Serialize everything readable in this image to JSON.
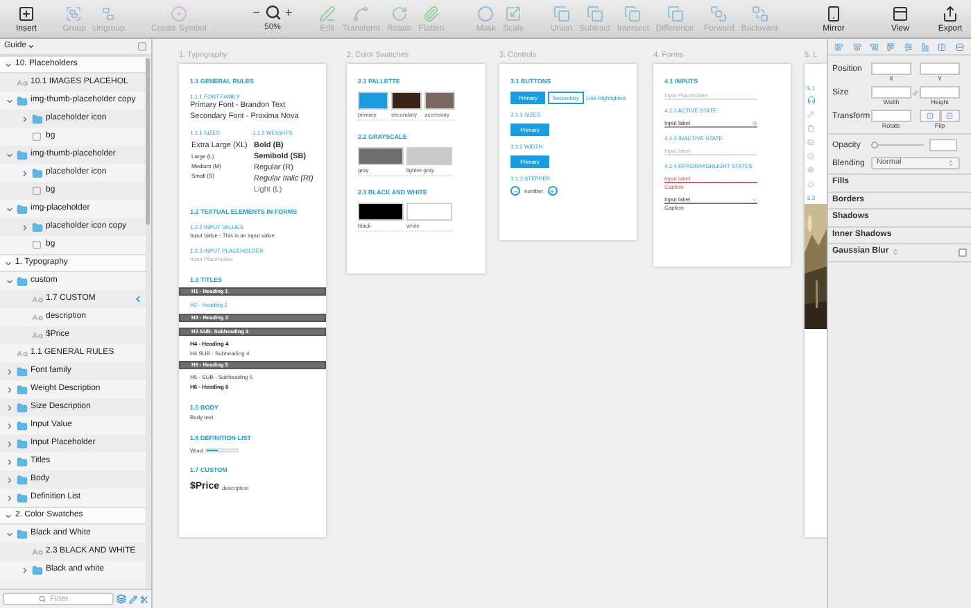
{
  "toolbar": {
    "groups": [
      [
        {
          "kind": "tool",
          "label": "Insert",
          "disabled": false
        }
      ],
      [
        {
          "kind": "tool",
          "label": "Group",
          "disabled": true
        },
        {
          "kind": "tool",
          "label": "Ungroup",
          "disabled": true
        }
      ],
      [
        {
          "kind": "tool",
          "label": "Create Symbol",
          "disabled": true
        }
      ],
      [
        {
          "kind": "zoom",
          "minus": "−",
          "plus": "+",
          "value": "50%"
        }
      ],
      [
        {
          "kind": "tool",
          "label": "Edit",
          "disabled": true
        },
        {
          "kind": "tool",
          "label": "Transform",
          "disabled": true
        },
        {
          "kind": "tool",
          "label": "Rotate",
          "disabled": true
        },
        {
          "kind": "tool",
          "label": "Flatten",
          "disabled": true
        }
      ],
      [
        {
          "kind": "tool",
          "label": "Mask",
          "disabled": true
        },
        {
          "kind": "tool",
          "label": "Scale",
          "disabled": true
        }
      ],
      [
        {
          "kind": "tool",
          "label": "Union",
          "disabled": true
        },
        {
          "kind": "tool",
          "label": "Subtract",
          "disabled": true
        },
        {
          "kind": "tool",
          "label": "Intersect",
          "disabled": true
        },
        {
          "kind": "tool",
          "label": "Difference",
          "disabled": true
        }
      ],
      [
        {
          "kind": "tool",
          "label": "Forward",
          "disabled": true
        },
        {
          "kind": "tool",
          "label": "Backward",
          "disabled": true
        }
      ],
      [
        {
          "kind": "tool",
          "label": "Mirror",
          "disabled": false
        }
      ],
      [
        {
          "kind": "tool",
          "label": "View",
          "disabled": false
        }
      ],
      [
        {
          "kind": "tool",
          "label": "Export",
          "disabled": false
        }
      ]
    ]
  },
  "sidebar": {
    "page": "Guide",
    "filter": {
      "placeholder": "Filter"
    },
    "layers": [
      {
        "kind": "artboard",
        "name": "10. Placeholders",
        "expanded": true,
        "children": [
          {
            "kind": "text",
            "name": "10.1 IMAGES PLACEHOL"
          },
          {
            "kind": "folder",
            "name": "img-thumb-placeholder copy",
            "expanded": true,
            "children": [
              {
                "kind": "folder",
                "name": "placeholder icon",
                "expanded": false
              },
              {
                "kind": "shape",
                "name": "bg"
              }
            ]
          },
          {
            "kind": "folder",
            "name": "img-thumb-placeholder",
            "expanded": true,
            "children": [
              {
                "kind": "folder",
                "name": "placeholder icon",
                "expanded": false
              },
              {
                "kind": "shape",
                "name": "bg"
              }
            ]
          },
          {
            "kind": "folder",
            "name": "img-placeholder",
            "expanded": true,
            "children": [
              {
                "kind": "folder",
                "name": "placeholder icon copy",
                "expanded": false
              },
              {
                "kind": "shape",
                "name": "bg"
              }
            ]
          }
        ]
      },
      {
        "kind": "artboard",
        "name": "1. Typography",
        "expanded": true,
        "children": [
          {
            "kind": "folder",
            "name": "custom",
            "expanded": true,
            "children": [
              {
                "kind": "text",
                "name": "1.7 CUSTOM",
                "marked": true
              },
              {
                "kind": "text",
                "name": "description",
                "marked": false
              },
              {
                "kind": "text",
                "name": "$Price",
                "marked": false
              }
            ]
          },
          {
            "kind": "text",
            "name": "1.1 GENERAL RULES"
          },
          {
            "kind": "folder",
            "name": "Font family",
            "expanded": false
          },
          {
            "kind": "folder",
            "name": "Weight Description",
            "expanded": false
          },
          {
            "kind": "folder",
            "name": "Size Description",
            "expanded": false
          },
          {
            "kind": "folder",
            "name": "Input Value",
            "expanded": false
          },
          {
            "kind": "folder",
            "name": "Input Placeholder",
            "expanded": false
          },
          {
            "kind": "folder",
            "name": "Titles",
            "expanded": false
          },
          {
            "kind": "folder",
            "name": "Body",
            "expanded": false
          },
          {
            "kind": "folder",
            "name": "Definition List",
            "expanded": false
          }
        ]
      },
      {
        "kind": "artboard",
        "name": "2. Color Swatches",
        "expanded": true,
        "children": [
          {
            "kind": "folder",
            "name": "Black and White",
            "expanded": true,
            "children": [
              {
                "kind": "text",
                "name": "2.3 BLACK AND WHITE"
              },
              {
                "kind": "folder",
                "name": "Black and white",
                "expanded": false
              }
            ]
          }
        ]
      }
    ]
  },
  "canvas": {
    "artboards": [
      {
        "title": "1. Typography",
        "items": [
          {
            "kind": "heading",
            "text": "1.1 GENERAL RULES"
          },
          {
            "kind": "subheading",
            "text": "1.1.1 FONT FAMILY"
          },
          {
            "kind": "text",
            "text": "Primary Font - Brandon Text"
          },
          {
            "kind": "text",
            "text": "Secondary Font - Proxima Nova"
          },
          {
            "kind": "columns",
            "columns": [
              {
                "title": "1.1.1 SIZES",
                "entries": [
                  {
                    "kind": "xl",
                    "text": "Extra Large (XL)"
                  },
                  {
                    "kind": "small",
                    "text": "Large (L)"
                  },
                  {
                    "kind": "small",
                    "text": "Medium (M)"
                  },
                  {
                    "kind": "small",
                    "text": "Small (S)"
                  }
                ]
              },
              {
                "title": "1.1.2 WEIGHTS",
                "entries": [
                  {
                    "kind": "bold",
                    "text": "Bold (B)"
                  },
                  {
                    "kind": "semibold",
                    "text": "Semibold (SB)"
                  },
                  {
                    "kind": "regular",
                    "text": "Regular (R)"
                  },
                  {
                    "kind": "italic",
                    "text": "Regular Italic (RI)"
                  },
                  {
                    "kind": "light",
                    "text": "Light (L)"
                  }
                ]
              }
            ]
          },
          {
            "kind": "heading",
            "text": "1.2 TEXTUAL ELEMENTS IN FORMS"
          },
          {
            "kind": "subheading",
            "text": "1.2.2 INPUT VALUES"
          },
          {
            "kind": "small",
            "text": "Input Value - This is an input value"
          },
          {
            "kind": "subheading",
            "text": "1.2.3 INPUT PLACEHOLDER"
          },
          {
            "kind": "placeholder",
            "text": "Input Placeholder"
          },
          {
            "kind": "heading",
            "text": "1.3 TITLES"
          },
          {
            "kind": "titlebar",
            "text": "H1 - Heading 1"
          },
          {
            "kind": "blue",
            "text": "H2 - Heading 2"
          },
          {
            "kind": "titlebar",
            "text": "H3 - Heading 3"
          },
          {
            "kind": "titlebar",
            "text": "H3 SUB- Subheading 3"
          },
          {
            "kind": "bold",
            "text": "H4 - Heading 4"
          },
          {
            "kind": "small",
            "text": "H4 SUB - Subheading 4"
          },
          {
            "kind": "titlebar",
            "text": "H5 - Heading 5"
          },
          {
            "kind": "small",
            "text": "H5 - SUB - Subheading 5"
          },
          {
            "kind": "bold",
            "text": "H6 - Heading 6"
          },
          {
            "kind": "heading",
            "text": "1.5 BODY"
          },
          {
            "kind": "small",
            "text": "Body text"
          },
          {
            "kind": "heading",
            "text": "1.6 DEFINITION LIST"
          },
          {
            "kind": "meter",
            "label": "Word",
            "level": 0.35
          },
          {
            "kind": "heading",
            "text": "1.7 CUSTOM"
          },
          {
            "kind": "price",
            "text": "$Price",
            "note": "description"
          }
        ]
      },
      {
        "title": "2. Color Swatches",
        "items": [
          {
            "kind": "heading",
            "text": "2.1 PALLETTE"
          },
          {
            "kind": "swatches",
            "swatches": [
              {
                "label": "primary",
                "color": "#1a9de0"
              },
              {
                "label": "secondary",
                "color": "#3a2418"
              },
              {
                "label": "accessory",
                "color": "#7d6762"
              }
            ]
          },
          {
            "kind": "heading",
            "text": "2.2 GRAYSCALE"
          },
          {
            "kind": "swatches",
            "swatches": [
              {
                "label": "gray",
                "color": "#6f6f6f"
              },
              {
                "label": "lighter-gray",
                "color": "#c9c9c9"
              }
            ]
          },
          {
            "kind": "heading",
            "text": "2.3 BLACK AND WHITE"
          },
          {
            "kind": "swatches",
            "swatches": [
              {
                "label": "black",
                "color": "#000000"
              },
              {
                "label": "white",
                "color": "#ffffff"
              }
            ]
          }
        ]
      },
      {
        "title": "3. Controls",
        "items": [
          {
            "kind": "heading",
            "text": "3.1 BUTTONS"
          },
          {
            "kind": "buttons",
            "buttons": [
              {
                "kind": "primary",
                "label": "Primary"
              },
              {
                "kind": "secondary",
                "label": "Secondary"
              },
              {
                "kind": "link",
                "label": "Link Highlighted"
              }
            ]
          },
          {
            "kind": "subheading",
            "text": "3.1.1 SIZES"
          },
          {
            "kind": "buttons",
            "buttons": [
              {
                "kind": "primary",
                "label": "Primary"
              }
            ]
          },
          {
            "kind": "subheading",
            "text": "3.1.2 WIDTH"
          },
          {
            "kind": "buttons",
            "buttons": [
              {
                "kind": "primary",
                "label": "Primary"
              }
            ]
          },
          {
            "kind": "subheading",
            "text": "3.1.3 STEPPER"
          },
          {
            "kind": "stepper",
            "value": "number"
          }
        ]
      },
      {
        "title": "4. Forms",
        "items": [
          {
            "kind": "heading",
            "text": "4.1 INPUTS"
          },
          {
            "kind": "input",
            "field": {
              "kind": "placeholder",
              "text": "Input Placeholder"
            }
          },
          {
            "kind": "subheading",
            "text": "4.1.2 ACTIVE STATE"
          },
          {
            "kind": "input",
            "field": {
              "kind": "active",
              "text": "Input label"
            }
          },
          {
            "kind": "subheading",
            "text": "4.1.3 INACTIVE STATE"
          },
          {
            "kind": "input",
            "field": {
              "kind": "inactive",
              "text": "Input label"
            }
          },
          {
            "kind": "subheading",
            "text": "4.1.4 ERROR/HIGHLIGHT STATES"
          },
          {
            "kind": "input",
            "field": {
              "kind": "error",
              "text": "Input label",
              "caption": "Caption"
            }
          },
          {
            "kind": "input",
            "field": {
              "kind": "select",
              "text": "Input label",
              "caption": "Caption"
            }
          }
        ]
      },
      {
        "title": "5. L",
        "items": [
          {
            "kind": "subheading",
            "text": "5.1"
          },
          {
            "kind": "icons"
          },
          {
            "kind": "subheading",
            "text": "5.2"
          },
          {
            "kind": "picture"
          }
        ]
      }
    ]
  },
  "inspector": {
    "position": {
      "label": "Position",
      "captions": [
        "X",
        "Y"
      ]
    },
    "size": {
      "label": "Size",
      "captions": [
        "Width",
        "Height"
      ]
    },
    "transform": {
      "label": "Transform",
      "caption": "Rotate",
      "flip_caption": "Flip"
    },
    "opacity": {
      "label": "Opacity",
      "level": 0
    },
    "blending": {
      "label": "Blending",
      "value": "Normal"
    },
    "sections": [
      {
        "kind": "plain",
        "label": "Fills"
      },
      {
        "kind": "plain",
        "label": "Borders"
      },
      {
        "kind": "plain",
        "label": "Shadows"
      },
      {
        "kind": "plain",
        "label": "Inner Shadows"
      },
      {
        "kind": "toggle",
        "label": "Gaussian Blur",
        "checked": false
      }
    ]
  }
}
